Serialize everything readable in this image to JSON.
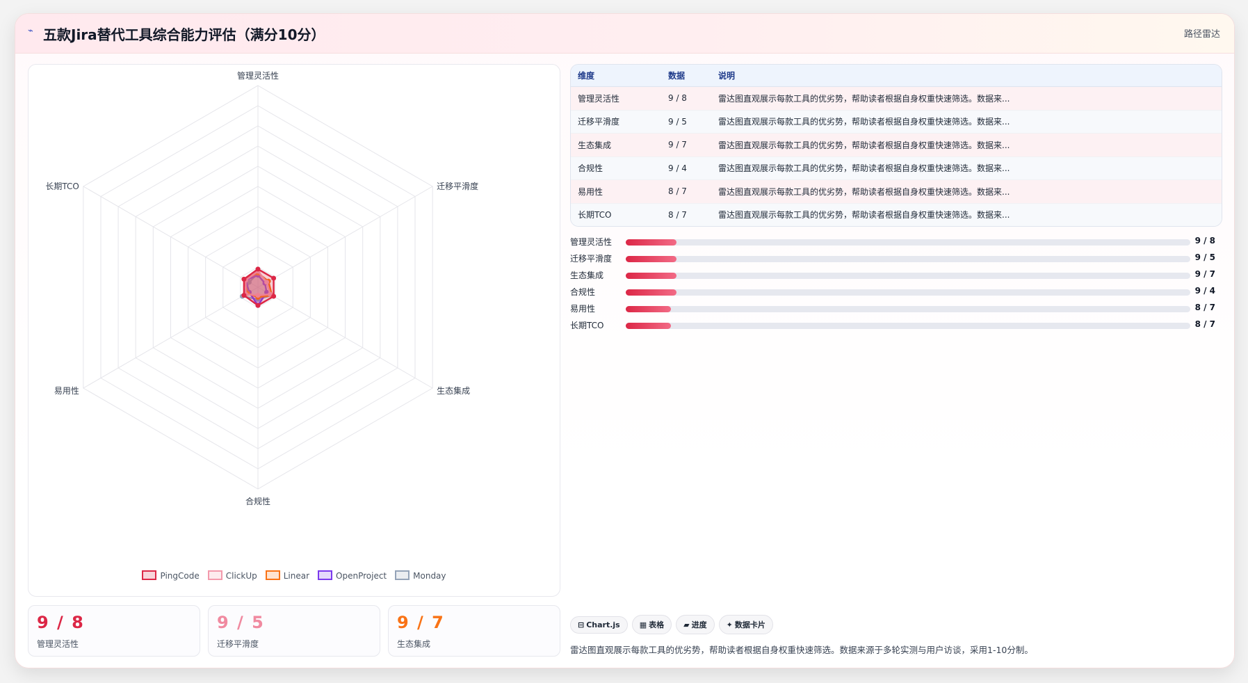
{
  "header": {
    "icon": "radar-logo-icon",
    "title": "五款Jira替代工具综合能力评估（满分10分）",
    "tag": "路径雷达"
  },
  "chart_data": {
    "type": "radar",
    "title": "五款Jira替代工具综合能力评估（满分10分）",
    "axes": [
      "管理灵活性",
      "迁移平滑度",
      "生态集成",
      "合规性",
      "易用性",
      "长期TCO"
    ],
    "range": [
      0,
      100
    ],
    "grid_levels": 10,
    "legend_position": "bottom",
    "series": [
      {
        "name": "PingCode",
        "color": "#dc2746",
        "values": [
          9,
          9,
          9,
          9,
          8,
          8
        ]
      },
      {
        "name": "ClickUp",
        "color": "#f39aac",
        "values": [
          8,
          5,
          7,
          4,
          7,
          7
        ]
      },
      {
        "name": "Linear",
        "color": "#f97316",
        "values": [
          7,
          6,
          8,
          5,
          6,
          8
        ]
      },
      {
        "name": "OpenProject",
        "color": "#7c3aed",
        "values": [
          6,
          4,
          5,
          9,
          5,
          7
        ]
      },
      {
        "name": "Monday",
        "color": "#94a3b8",
        "values": [
          7,
          6,
          8,
          6,
          9,
          5
        ]
      }
    ]
  },
  "table": {
    "headers": [
      "维度",
      "数据",
      "说明"
    ],
    "rows": [
      {
        "dim": "管理灵活性",
        "data": "9 / 8",
        "note": "雷达图直观展示每款工具的优劣势，帮助读者根据自身权重快速筛选。数据来..."
      },
      {
        "dim": "迁移平滑度",
        "data": "9 / 5",
        "note": "雷达图直观展示每款工具的优劣势，帮助读者根据自身权重快速筛选。数据来..."
      },
      {
        "dim": "生态集成",
        "data": "9 / 7",
        "note": "雷达图直观展示每款工具的优劣势，帮助读者根据自身权重快速筛选。数据来..."
      },
      {
        "dim": "合规性",
        "data": "9 / 4",
        "note": "雷达图直观展示每款工具的优劣势，帮助读者根据自身权重快速筛选。数据来..."
      },
      {
        "dim": "易用性",
        "data": "8 / 7",
        "note": "雷达图直观展示每款工具的优劣势，帮助读者根据自身权重快速筛选。数据来..."
      },
      {
        "dim": "长期TCO",
        "data": "8 / 7",
        "note": "雷达图直观展示每款工具的优劣势，帮助读者根据自身权重快速筛选。数据来..."
      }
    ]
  },
  "bars": [
    {
      "label": "管理灵活性",
      "value": "9 / 8",
      "fill": 0.09
    },
    {
      "label": "迁移平滑度",
      "value": "9 / 5",
      "fill": 0.09
    },
    {
      "label": "生态集成",
      "value": "9 / 7",
      "fill": 0.09
    },
    {
      "label": "合规性",
      "value": "9 / 4",
      "fill": 0.09
    },
    {
      "label": "易用性",
      "value": "8 / 7",
      "fill": 0.08
    },
    {
      "label": "长期TCO",
      "value": "8 / 7",
      "fill": 0.08
    }
  ],
  "kpis": [
    {
      "value": "9 / 8",
      "label": "管理灵活性",
      "color": "#dc2746"
    },
    {
      "value": "9 / 5",
      "label": "迁移平滑度",
      "color": "#f08aa0"
    },
    {
      "value": "9 / 7",
      "label": "生态集成",
      "color": "#f97316"
    }
  ],
  "chips": [
    {
      "icon": "chart-icon",
      "glyph": "⊟",
      "label": "Chart.js"
    },
    {
      "icon": "table-icon",
      "glyph": "▦",
      "label": "表格"
    },
    {
      "icon": "progress-icon",
      "glyph": "▰",
      "label": "进度"
    },
    {
      "icon": "sparkle-icon",
      "glyph": "✦",
      "label": "数据卡片"
    }
  ],
  "note": "雷达图直观展示每款工具的优劣势，帮助读者根据自身权重快速筛选。数据来源于多轮实测与用户访谈，采用1-10分制。"
}
